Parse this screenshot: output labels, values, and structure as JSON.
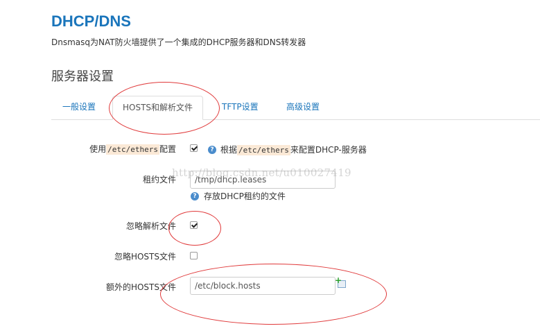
{
  "header": {
    "title": "DHCP/DNS",
    "description": "Dnsmasq为NAT防火墙提供了一个集成的DHCP服务器和DNS转发器"
  },
  "section": {
    "title": "服务器设置"
  },
  "tabs": [
    {
      "label": "一般设置"
    },
    {
      "label": "HOSTS和解析文件"
    },
    {
      "label": "TFTP设置"
    },
    {
      "label": "高级设置"
    }
  ],
  "form": {
    "use_ethers": {
      "label_prefix": "使用",
      "label_code": "/etc/ethers",
      "label_suffix": "配置",
      "checked": true,
      "help_prefix": "根据",
      "help_code": "/etc/ethers",
      "help_suffix": "来配置DHCP-服务器"
    },
    "leasefile": {
      "label": "租约文件",
      "value": "/tmp/dhcp.leases",
      "help": "存放DHCP租约的文件"
    },
    "noresolv": {
      "label": "忽略解析文件",
      "checked": true
    },
    "nohosts": {
      "label": "忽略HOSTS文件",
      "checked": false
    },
    "addnhosts": {
      "label": "额外的HOSTS文件",
      "value": "/etc/block.hosts"
    }
  },
  "watermark": "http://blog.csdn.net/u010027419",
  "colors": {
    "accent": "#1a75bb",
    "annotation": "#e0393a",
    "code_bg": "#fbe9d6"
  }
}
